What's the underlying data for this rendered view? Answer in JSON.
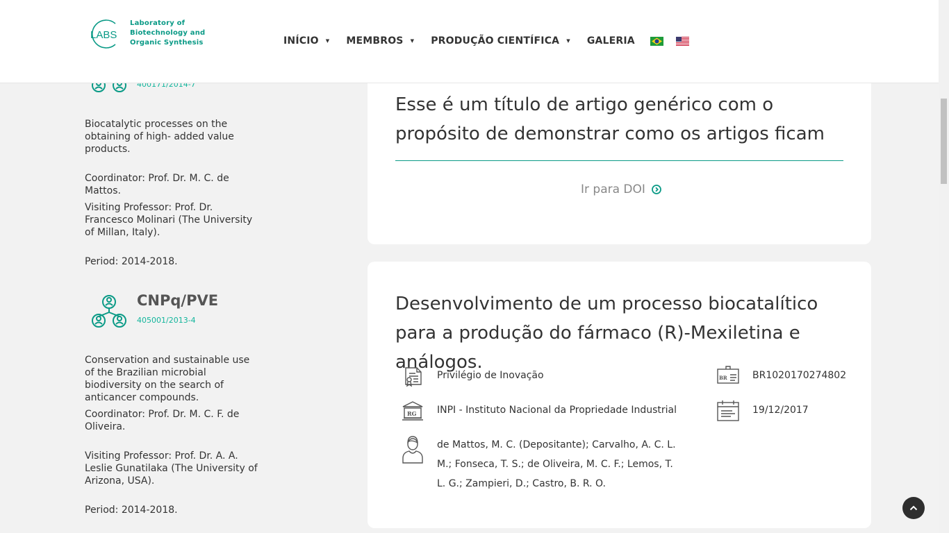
{
  "logo": {
    "mark": "LABS",
    "line1": "Laboratory  of",
    "line2": "Biotechnology  and",
    "line3": "Organic  Synthesis"
  },
  "nav": {
    "items": [
      {
        "label": "INÍCIO",
        "dropdown": true
      },
      {
        "label": "MEMBROS",
        "dropdown": true
      },
      {
        "label": "PRODUÇÃO CIENTÍFICA",
        "dropdown": true
      },
      {
        "label": "GALERIA",
        "dropdown": false
      }
    ],
    "flags": [
      "brazil-flag-icon",
      "us-flag-icon"
    ]
  },
  "projects": [
    {
      "code": "400171/2014-7",
      "description": "Biocatalytic processes on the obtaining of high- added value products.",
      "coordinator": "Coordinator: Prof. Dr. M. C. de Mattos.",
      "visiting": "Visiting Professor: Prof. Dr. Francesco Molinari (The University of Millan, Italy).",
      "period": "Period: 2014-2018."
    },
    {
      "title": "CNPq/PVE",
      "code": "405001/2013-4",
      "description": "Conservation and sustainable use of the Brazilian microbial biodiversity on the search of anticancer compounds.",
      "coordinator": "Coordinator: Prof. Dr. M. C. F. de Oliveira.",
      "visiting": "Visiting Professor: Prof. Dr. A. A. Leslie Gunatilaka (The University of Arizona, USA).",
      "period": "Period: 2014-2018."
    }
  ],
  "articles": [
    {
      "title": "Esse é um título de artigo genérico com o propósito de demonstrar como os artigos ficam",
      "doi_label": "Ir para DOI"
    }
  ],
  "patent": {
    "title": "Desenvolvimento de um processo biocatalítico para a produção do fármaco (R)-Mexiletina e análogos.",
    "type": "Privilégio de Inovação",
    "number": "BR1020170274802",
    "institution": "INPI - Instituto Nacional da Propriedade Industrial",
    "date": "19/12/2017",
    "authors": "de Mattos, M. C. (Depositante); Carvalho, A. C. L. M.; Fonseca, T. S.; de Oliveira, M. C. F.; Lemos, T. L. G.; Zampieri, D.; Castro, B. R. O.",
    "icon_labels": {
      "number_badge": "BR",
      "institution_badge": "RG"
    }
  },
  "colors": {
    "accent": "#0a9a86",
    "code": "#12b59c"
  }
}
